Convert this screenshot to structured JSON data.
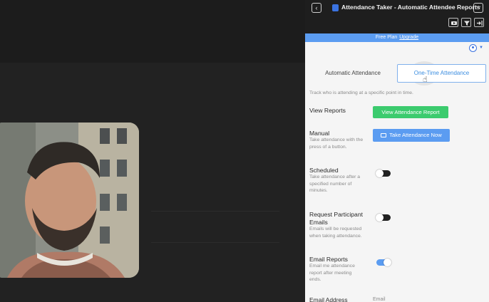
{
  "window": {
    "title": "Attendance Taker - Automatic Attendee Reports",
    "back_icon": "chevron-left-icon",
    "more_icon": "ellipsis-icon",
    "tools": [
      "video-icon",
      "filter-icon",
      "exit-panel-icon"
    ]
  },
  "plan_bar": {
    "text": "Free Plan",
    "upgrade_label": "Upgrade"
  },
  "tabs": [
    {
      "label": "Automatic Attendance",
      "selected": false
    },
    {
      "label": "One-Time Attendance",
      "selected": true
    }
  ],
  "description": "Track who is attending at a specific point in time.",
  "view_reports": {
    "label": "View Reports",
    "button_label": "View Attendance Report"
  },
  "manual": {
    "label": "Manual",
    "sub": "Take attendance with the press of a button.",
    "button_label": "Take Attendance Now"
  },
  "scheduled": {
    "label": "Scheduled",
    "sub": "Take attendance after a specified number of minutes.",
    "enabled": false
  },
  "request_emails": {
    "label": "Request Participant Emails",
    "sub": "Emails will be requested when taking attendance.",
    "enabled": false
  },
  "email_reports": {
    "label": "Email Reports",
    "sub": "Email me attendance report after meeting ends.",
    "enabled": true
  },
  "email_address": {
    "label": "Email Address",
    "placeholder": "Email"
  },
  "colors": {
    "accent_blue": "#5b9cf1",
    "green": "#3ccb6e",
    "dark": "#1e1e1e"
  }
}
